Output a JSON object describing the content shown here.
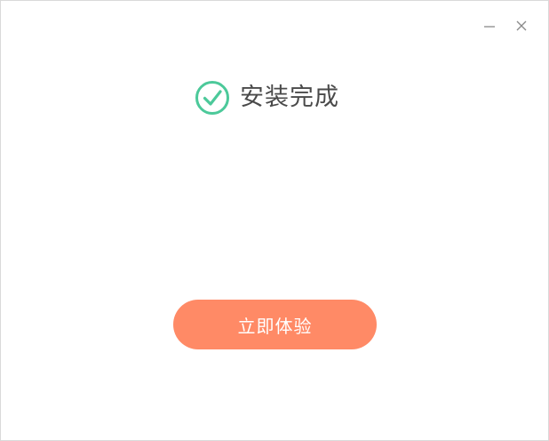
{
  "window": {
    "controls": {
      "minimize_icon": "minimize-icon",
      "close_icon": "close-icon"
    }
  },
  "status": {
    "icon": "check-circle-icon",
    "icon_color": "#4cc99a",
    "text": "安装完成"
  },
  "action": {
    "label": "立即体验",
    "color": "#ff8a66"
  }
}
